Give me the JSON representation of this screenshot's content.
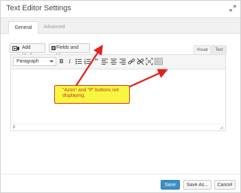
{
  "dialog": {
    "title": "Text Editor Settings",
    "expand_icon": "expand-diagonal-arrows-icon"
  },
  "tabs": [
    {
      "label": "General",
      "active": true
    },
    {
      "label": "Advanced",
      "active": false
    }
  ],
  "media_buttons": {
    "add_media": {
      "label": "Add Media",
      "icon": "media-camera-icon"
    },
    "fields_and_views": {
      "label": "Fields and Views",
      "icon": "plus-square-icon"
    }
  },
  "editor_modes": {
    "visual": "Visual",
    "text": "Text"
  },
  "toolbar": {
    "format_select": "Paragraph",
    "buttons": [
      "bold-icon",
      "italic-icon",
      "bullet-list-icon",
      "numbered-list-icon",
      "blockquote-icon",
      "align-left-icon",
      "align-center-icon",
      "align-right-icon",
      "insert-link-icon",
      "remove-link-icon",
      "fullscreen-icon",
      "toolbar-toggle-icon"
    ]
  },
  "editor": {
    "content": "",
    "status_path": "p"
  },
  "annotation": {
    "text": "\"Azon\" and \"If\" buttons not displaying.",
    "background": "#f7f73f",
    "border": "#d02a1f",
    "text_color": "#c3362b"
  },
  "footer": {
    "save": "Save",
    "save_as": "Save As...",
    "cancel": "Cancel"
  },
  "colors": {
    "primary_button": "#3a92c5",
    "annotation_arrow": "#e0241b"
  }
}
